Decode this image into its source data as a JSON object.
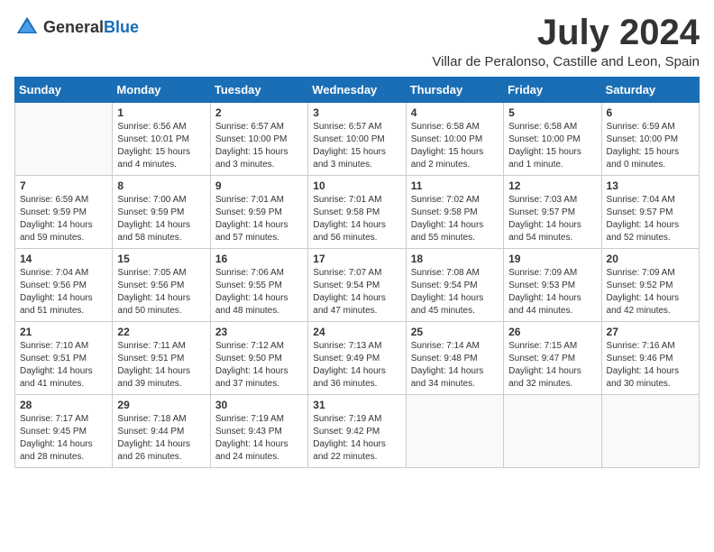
{
  "header": {
    "logo": {
      "text_general": "General",
      "text_blue": "Blue"
    },
    "month": "July 2024",
    "location": "Villar de Peralonso, Castille and Leon, Spain"
  },
  "weekdays": [
    "Sunday",
    "Monday",
    "Tuesday",
    "Wednesday",
    "Thursday",
    "Friday",
    "Saturday"
  ],
  "weeks": [
    [
      {
        "day": "",
        "info": ""
      },
      {
        "day": "1",
        "info": "Sunrise: 6:56 AM\nSunset: 10:01 PM\nDaylight: 15 hours\nand 4 minutes."
      },
      {
        "day": "2",
        "info": "Sunrise: 6:57 AM\nSunset: 10:00 PM\nDaylight: 15 hours\nand 3 minutes."
      },
      {
        "day": "3",
        "info": "Sunrise: 6:57 AM\nSunset: 10:00 PM\nDaylight: 15 hours\nand 3 minutes."
      },
      {
        "day": "4",
        "info": "Sunrise: 6:58 AM\nSunset: 10:00 PM\nDaylight: 15 hours\nand 2 minutes."
      },
      {
        "day": "5",
        "info": "Sunrise: 6:58 AM\nSunset: 10:00 PM\nDaylight: 15 hours\nand 1 minute."
      },
      {
        "day": "6",
        "info": "Sunrise: 6:59 AM\nSunset: 10:00 PM\nDaylight: 15 hours\nand 0 minutes."
      }
    ],
    [
      {
        "day": "7",
        "info": "Sunrise: 6:59 AM\nSunset: 9:59 PM\nDaylight: 14 hours\nand 59 minutes."
      },
      {
        "day": "8",
        "info": "Sunrise: 7:00 AM\nSunset: 9:59 PM\nDaylight: 14 hours\nand 58 minutes."
      },
      {
        "day": "9",
        "info": "Sunrise: 7:01 AM\nSunset: 9:59 PM\nDaylight: 14 hours\nand 57 minutes."
      },
      {
        "day": "10",
        "info": "Sunrise: 7:01 AM\nSunset: 9:58 PM\nDaylight: 14 hours\nand 56 minutes."
      },
      {
        "day": "11",
        "info": "Sunrise: 7:02 AM\nSunset: 9:58 PM\nDaylight: 14 hours\nand 55 minutes."
      },
      {
        "day": "12",
        "info": "Sunrise: 7:03 AM\nSunset: 9:57 PM\nDaylight: 14 hours\nand 54 minutes."
      },
      {
        "day": "13",
        "info": "Sunrise: 7:04 AM\nSunset: 9:57 PM\nDaylight: 14 hours\nand 52 minutes."
      }
    ],
    [
      {
        "day": "14",
        "info": "Sunrise: 7:04 AM\nSunset: 9:56 PM\nDaylight: 14 hours\nand 51 minutes."
      },
      {
        "day": "15",
        "info": "Sunrise: 7:05 AM\nSunset: 9:56 PM\nDaylight: 14 hours\nand 50 minutes."
      },
      {
        "day": "16",
        "info": "Sunrise: 7:06 AM\nSunset: 9:55 PM\nDaylight: 14 hours\nand 48 minutes."
      },
      {
        "day": "17",
        "info": "Sunrise: 7:07 AM\nSunset: 9:54 PM\nDaylight: 14 hours\nand 47 minutes."
      },
      {
        "day": "18",
        "info": "Sunrise: 7:08 AM\nSunset: 9:54 PM\nDaylight: 14 hours\nand 45 minutes."
      },
      {
        "day": "19",
        "info": "Sunrise: 7:09 AM\nSunset: 9:53 PM\nDaylight: 14 hours\nand 44 minutes."
      },
      {
        "day": "20",
        "info": "Sunrise: 7:09 AM\nSunset: 9:52 PM\nDaylight: 14 hours\nand 42 minutes."
      }
    ],
    [
      {
        "day": "21",
        "info": "Sunrise: 7:10 AM\nSunset: 9:51 PM\nDaylight: 14 hours\nand 41 minutes."
      },
      {
        "day": "22",
        "info": "Sunrise: 7:11 AM\nSunset: 9:51 PM\nDaylight: 14 hours\nand 39 minutes."
      },
      {
        "day": "23",
        "info": "Sunrise: 7:12 AM\nSunset: 9:50 PM\nDaylight: 14 hours\nand 37 minutes."
      },
      {
        "day": "24",
        "info": "Sunrise: 7:13 AM\nSunset: 9:49 PM\nDaylight: 14 hours\nand 36 minutes."
      },
      {
        "day": "25",
        "info": "Sunrise: 7:14 AM\nSunset: 9:48 PM\nDaylight: 14 hours\nand 34 minutes."
      },
      {
        "day": "26",
        "info": "Sunrise: 7:15 AM\nSunset: 9:47 PM\nDaylight: 14 hours\nand 32 minutes."
      },
      {
        "day": "27",
        "info": "Sunrise: 7:16 AM\nSunset: 9:46 PM\nDaylight: 14 hours\nand 30 minutes."
      }
    ],
    [
      {
        "day": "28",
        "info": "Sunrise: 7:17 AM\nSunset: 9:45 PM\nDaylight: 14 hours\nand 28 minutes."
      },
      {
        "day": "29",
        "info": "Sunrise: 7:18 AM\nSunset: 9:44 PM\nDaylight: 14 hours\nand 26 minutes."
      },
      {
        "day": "30",
        "info": "Sunrise: 7:19 AM\nSunset: 9:43 PM\nDaylight: 14 hours\nand 24 minutes."
      },
      {
        "day": "31",
        "info": "Sunrise: 7:19 AM\nSunset: 9:42 PM\nDaylight: 14 hours\nand 22 minutes."
      },
      {
        "day": "",
        "info": ""
      },
      {
        "day": "",
        "info": ""
      },
      {
        "day": "",
        "info": ""
      }
    ]
  ]
}
